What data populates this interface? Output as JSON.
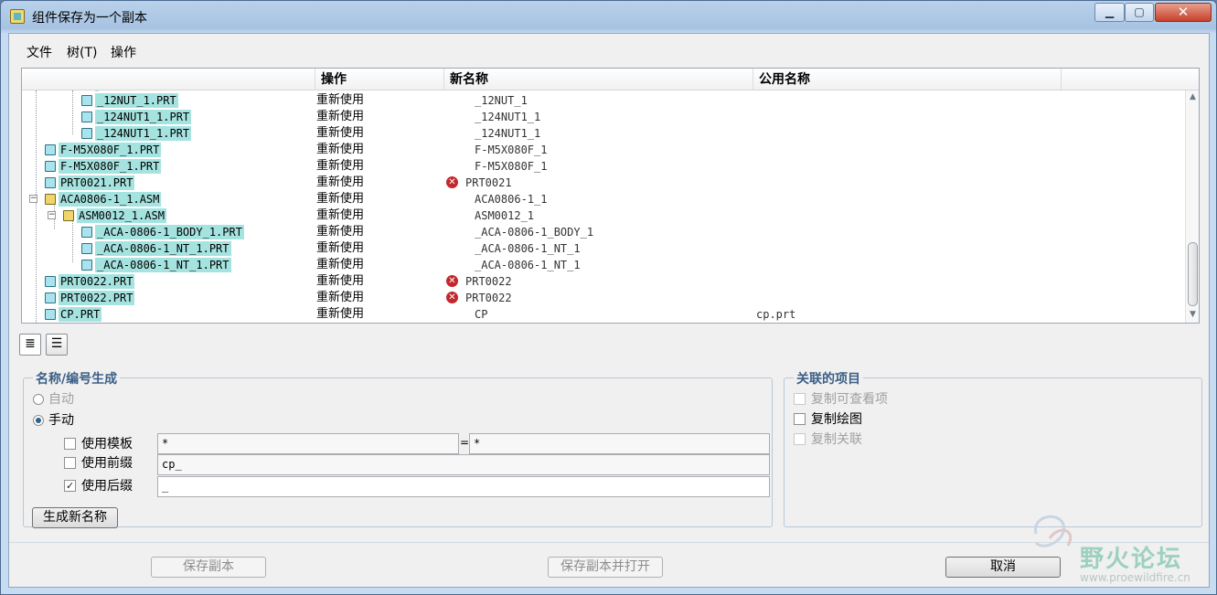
{
  "window": {
    "title": "组件保存为一个副本",
    "min_label": "▁",
    "max_label": "▢",
    "close_label": "✕"
  },
  "menu": {
    "items": [
      "文件",
      "树(T)",
      "操作"
    ]
  },
  "table": {
    "columns": [
      "操作",
      "新名称",
      "公用名称"
    ],
    "rows": [
      {
        "name": "_12NUT_1.PRT",
        "type": "part",
        "op": "重新使用",
        "new_name": "_12NUT_1",
        "common": "",
        "error": false
      },
      {
        "name": "_124NUT1_1.PRT",
        "type": "part",
        "op": "重新使用",
        "new_name": "_124NUT1_1",
        "common": "",
        "error": false
      },
      {
        "name": "_124NUT1_1.PRT",
        "type": "part",
        "op": "重新使用",
        "new_name": "_124NUT1_1",
        "common": "",
        "error": false
      },
      {
        "name": "F-M5X080F_1.PRT",
        "type": "part",
        "op": "重新使用",
        "new_name": "F-M5X080F_1",
        "common": "",
        "error": false
      },
      {
        "name": "F-M5X080F_1.PRT",
        "type": "part",
        "op": "重新使用",
        "new_name": "F-M5X080F_1",
        "common": "",
        "error": false
      },
      {
        "name": "PRT0021.PRT",
        "type": "part",
        "op": "重新使用",
        "new_name": "PRT0021",
        "common": "",
        "error": true
      },
      {
        "name": "ACA0806-1_1.ASM",
        "type": "asm",
        "op": "重新使用",
        "new_name": "ACA0806-1_1",
        "common": "",
        "error": false
      },
      {
        "name": "ASM0012_1.ASM",
        "type": "asm",
        "op": "重新使用",
        "new_name": "ASM0012_1",
        "common": "",
        "error": false
      },
      {
        "name": "_ACA-0806-1_BODY_1.PRT",
        "type": "part",
        "op": "重新使用",
        "new_name": "_ACA-0806-1_BODY_1",
        "common": "",
        "error": false
      },
      {
        "name": "_ACA-0806-1_NT_1.PRT",
        "type": "part",
        "op": "重新使用",
        "new_name": "_ACA-0806-1_NT_1",
        "common": "",
        "error": false
      },
      {
        "name": "_ACA-0806-1_NT_1.PRT",
        "type": "part",
        "op": "重新使用",
        "new_name": "_ACA-0806-1_NT_1",
        "common": "",
        "error": false
      },
      {
        "name": "PRT0022.PRT",
        "type": "part",
        "op": "重新使用",
        "new_name": "PRT0022",
        "common": "",
        "error": true
      },
      {
        "name": "PRT0022.PRT",
        "type": "part",
        "op": "重新使用",
        "new_name": "PRT0022",
        "common": "",
        "error": true
      },
      {
        "name": "CP.PRT",
        "type": "part",
        "op": "重新使用",
        "new_name": "CP",
        "common": "cp.prt",
        "error": false
      }
    ]
  },
  "view_buttons": {
    "detail_icon": "≣",
    "list_icon": "☰"
  },
  "naming": {
    "title": "名称/编号生成",
    "auto_label": "自动",
    "manual_label": "手动",
    "use_template_label": "使用模板",
    "template_left": "*",
    "template_eq": "=",
    "template_right": "*",
    "use_prefix_label": "使用前缀",
    "prefix_value": "cp_",
    "use_suffix_label": "使用后缀",
    "suffix_value": "_",
    "generate_label": "生成新名称"
  },
  "related": {
    "title": "关联的项目",
    "copy_view_label": "复制可查看项",
    "copy_drawing_label": "复制绘图",
    "copy_assoc_label": "复制关联"
  },
  "footer": {
    "save_copy_label": "保存副本",
    "save_copy_open_label": "保存副本并打开",
    "cancel_label": "取消"
  },
  "watermark": {
    "text": "野火论坛",
    "url": "www.proewildfire.cn"
  }
}
